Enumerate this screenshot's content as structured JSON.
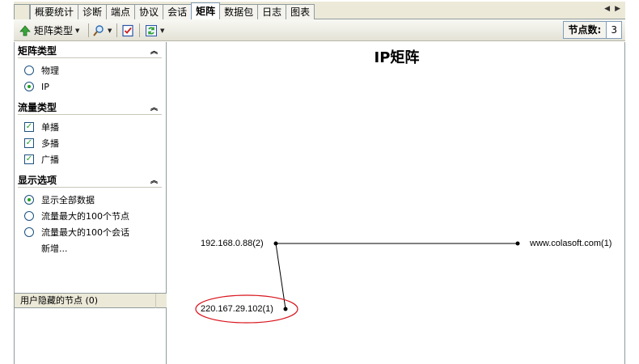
{
  "tabs": [
    "概要统计",
    "诊断",
    "端点",
    "协议",
    "会话",
    "矩阵",
    "数据包",
    "日志",
    "图表"
  ],
  "active_tab": "矩阵",
  "tab_nav": {
    "prev": "◀",
    "next": "▶"
  },
  "toolbar": {
    "matrix_type_label": "矩阵类型",
    "node_count_label": "节点数:",
    "node_count_value": "3"
  },
  "left_panel": {
    "matrix_type": {
      "title": "矩阵类型",
      "options": [
        "物理",
        "IP"
      ],
      "selected": "IP"
    },
    "traffic_type": {
      "title": "流量类型",
      "options": [
        "单播",
        "多播",
        "广播"
      ],
      "checked": [
        "单播",
        "多播",
        "广播"
      ]
    },
    "display_options": {
      "title": "显示选项",
      "options": [
        "显示全部数据",
        "流量最大的100个节点",
        "流量最大的100个会话"
      ],
      "selected": "显示全部数据",
      "extra": "新增..."
    },
    "hidden_nodes": {
      "title": "用户隐藏的节点 (0)"
    }
  },
  "main": {
    "title": "IP矩阵",
    "nodes": [
      "192.168.0.88(2)",
      "www.colasoft.com(1)",
      "220.167.29.102(1)"
    ],
    "highlight_color": "#d9141c"
  }
}
